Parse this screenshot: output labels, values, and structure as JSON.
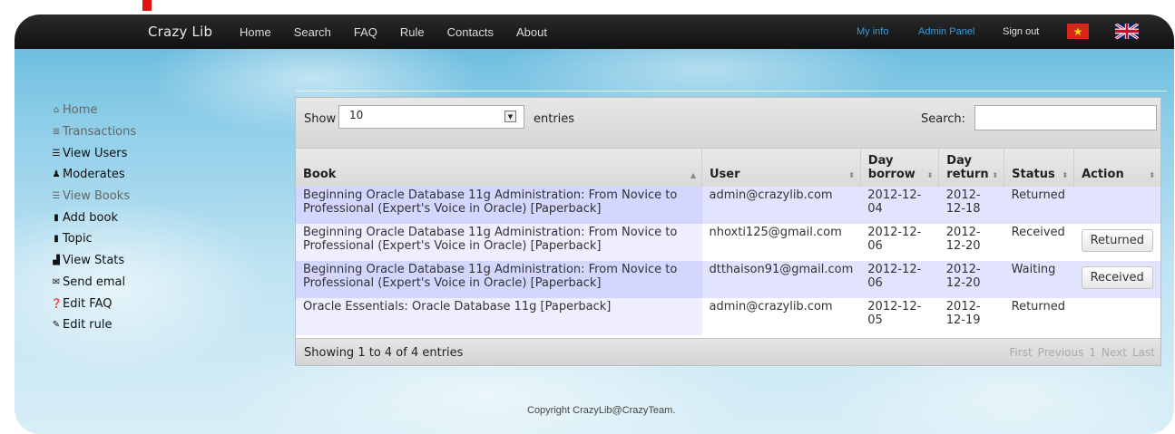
{
  "brand": "Crazy Lib",
  "nav": [
    "Home",
    "Search",
    "FAQ",
    "Rule",
    "Contacts",
    "About"
  ],
  "top_right": {
    "my_info": "My info",
    "admin_panel": "Admin Panel",
    "sign_out": "Sign out"
  },
  "flags": {
    "vn_star": "★"
  },
  "sidebar": [
    {
      "label": "Home",
      "icon": "home-icon",
      "glyph": "⌂",
      "muted": true
    },
    {
      "label": "Transactions",
      "icon": "list-icon",
      "glyph": "≣",
      "muted": true
    },
    {
      "label": "View Users",
      "icon": "table-icon",
      "glyph": "☰",
      "muted": false
    },
    {
      "label": "Moderates",
      "icon": "user-icon",
      "glyph": "♟",
      "muted": false
    },
    {
      "label": "View Books",
      "icon": "table-icon",
      "glyph": "☰",
      "muted": true
    },
    {
      "label": "Add book",
      "icon": "book-icon",
      "glyph": "▮",
      "muted": false
    },
    {
      "label": "Topic",
      "icon": "book-icon",
      "glyph": "▮",
      "muted": false
    },
    {
      "label": "View Stats",
      "icon": "signal-icon",
      "glyph": "▟",
      "muted": false
    },
    {
      "label": "Send emal",
      "icon": "envelope-icon",
      "glyph": "✉",
      "muted": false
    },
    {
      "label": "Edit FAQ",
      "icon": "question-icon",
      "glyph": "❓",
      "muted": false
    },
    {
      "label": "Edit rule",
      "icon": "wrench-icon",
      "glyph": "✎",
      "muted": false
    }
  ],
  "table_controls": {
    "show": "Show",
    "length_value": "10",
    "entries": "entries",
    "search": "Search:"
  },
  "columns": [
    "Book",
    "User",
    "Day borrow",
    "Day return",
    "Status",
    "Action"
  ],
  "rows": [
    {
      "book": "Beginning Oracle Database 11g Administration: From Novice to Professional (Expert's Voice in Oracle) [Paperback]",
      "user": "admin@crazylib.com",
      "borrow": "2012-12-04",
      "return": "2012-12-18",
      "status": "Returned",
      "action": ""
    },
    {
      "book": "Beginning Oracle Database 11g Administration: From Novice to Professional (Expert's Voice in Oracle) [Paperback]",
      "user": "nhoxti125@gmail.com",
      "borrow": "2012-12-06",
      "return": "2012-12-20",
      "status": "Received",
      "action": "Returned"
    },
    {
      "book": "Beginning Oracle Database 11g Administration: From Novice to Professional (Expert's Voice in Oracle) [Paperback]",
      "user": "dtthaison91@gmail.com",
      "borrow": "2012-12-06",
      "return": "2012-12-20",
      "status": "Waiting",
      "action": "Received"
    },
    {
      "book": "Oracle Essentials: Oracle Database 11g [Paperback]",
      "user": "admin@crazylib.com",
      "borrow": "2012-12-05",
      "return": "2012-12-19",
      "status": "Returned",
      "action": ""
    }
  ],
  "info": "Showing 1 to 4 of 4 entries",
  "paging": [
    "First",
    "Previous",
    "1",
    "Next",
    "Last"
  ],
  "footer": "Copyright CrazyLib@CrazyTeam."
}
